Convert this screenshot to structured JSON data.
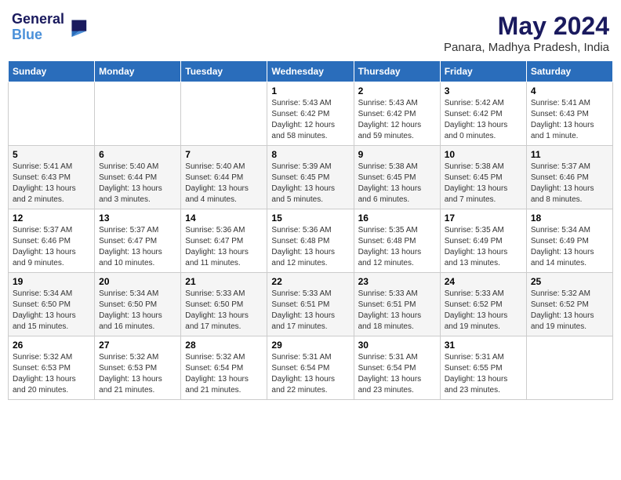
{
  "header": {
    "logo_line1": "General",
    "logo_line2": "Blue",
    "month_year": "May 2024",
    "location": "Panara, Madhya Pradesh, India"
  },
  "weekdays": [
    "Sunday",
    "Monday",
    "Tuesday",
    "Wednesday",
    "Thursday",
    "Friday",
    "Saturday"
  ],
  "weeks": [
    [
      {
        "day": "",
        "info": ""
      },
      {
        "day": "",
        "info": ""
      },
      {
        "day": "",
        "info": ""
      },
      {
        "day": "1",
        "info": "Sunrise: 5:43 AM\nSunset: 6:42 PM\nDaylight: 12 hours and 58 minutes."
      },
      {
        "day": "2",
        "info": "Sunrise: 5:43 AM\nSunset: 6:42 PM\nDaylight: 12 hours and 59 minutes."
      },
      {
        "day": "3",
        "info": "Sunrise: 5:42 AM\nSunset: 6:42 PM\nDaylight: 13 hours and 0 minutes."
      },
      {
        "day": "4",
        "info": "Sunrise: 5:41 AM\nSunset: 6:43 PM\nDaylight: 13 hours and 1 minute."
      }
    ],
    [
      {
        "day": "5",
        "info": "Sunrise: 5:41 AM\nSunset: 6:43 PM\nDaylight: 13 hours and 2 minutes."
      },
      {
        "day": "6",
        "info": "Sunrise: 5:40 AM\nSunset: 6:44 PM\nDaylight: 13 hours and 3 minutes."
      },
      {
        "day": "7",
        "info": "Sunrise: 5:40 AM\nSunset: 6:44 PM\nDaylight: 13 hours and 4 minutes."
      },
      {
        "day": "8",
        "info": "Sunrise: 5:39 AM\nSunset: 6:45 PM\nDaylight: 13 hours and 5 minutes."
      },
      {
        "day": "9",
        "info": "Sunrise: 5:38 AM\nSunset: 6:45 PM\nDaylight: 13 hours and 6 minutes."
      },
      {
        "day": "10",
        "info": "Sunrise: 5:38 AM\nSunset: 6:45 PM\nDaylight: 13 hours and 7 minutes."
      },
      {
        "day": "11",
        "info": "Sunrise: 5:37 AM\nSunset: 6:46 PM\nDaylight: 13 hours and 8 minutes."
      }
    ],
    [
      {
        "day": "12",
        "info": "Sunrise: 5:37 AM\nSunset: 6:46 PM\nDaylight: 13 hours and 9 minutes."
      },
      {
        "day": "13",
        "info": "Sunrise: 5:37 AM\nSunset: 6:47 PM\nDaylight: 13 hours and 10 minutes."
      },
      {
        "day": "14",
        "info": "Sunrise: 5:36 AM\nSunset: 6:47 PM\nDaylight: 13 hours and 11 minutes."
      },
      {
        "day": "15",
        "info": "Sunrise: 5:36 AM\nSunset: 6:48 PM\nDaylight: 13 hours and 12 minutes."
      },
      {
        "day": "16",
        "info": "Sunrise: 5:35 AM\nSunset: 6:48 PM\nDaylight: 13 hours and 12 minutes."
      },
      {
        "day": "17",
        "info": "Sunrise: 5:35 AM\nSunset: 6:49 PM\nDaylight: 13 hours and 13 minutes."
      },
      {
        "day": "18",
        "info": "Sunrise: 5:34 AM\nSunset: 6:49 PM\nDaylight: 13 hours and 14 minutes."
      }
    ],
    [
      {
        "day": "19",
        "info": "Sunrise: 5:34 AM\nSunset: 6:50 PM\nDaylight: 13 hours and 15 minutes."
      },
      {
        "day": "20",
        "info": "Sunrise: 5:34 AM\nSunset: 6:50 PM\nDaylight: 13 hours and 16 minutes."
      },
      {
        "day": "21",
        "info": "Sunrise: 5:33 AM\nSunset: 6:50 PM\nDaylight: 13 hours and 17 minutes."
      },
      {
        "day": "22",
        "info": "Sunrise: 5:33 AM\nSunset: 6:51 PM\nDaylight: 13 hours and 17 minutes."
      },
      {
        "day": "23",
        "info": "Sunrise: 5:33 AM\nSunset: 6:51 PM\nDaylight: 13 hours and 18 minutes."
      },
      {
        "day": "24",
        "info": "Sunrise: 5:33 AM\nSunset: 6:52 PM\nDaylight: 13 hours and 19 minutes."
      },
      {
        "day": "25",
        "info": "Sunrise: 5:32 AM\nSunset: 6:52 PM\nDaylight: 13 hours and 19 minutes."
      }
    ],
    [
      {
        "day": "26",
        "info": "Sunrise: 5:32 AM\nSunset: 6:53 PM\nDaylight: 13 hours and 20 minutes."
      },
      {
        "day": "27",
        "info": "Sunrise: 5:32 AM\nSunset: 6:53 PM\nDaylight: 13 hours and 21 minutes."
      },
      {
        "day": "28",
        "info": "Sunrise: 5:32 AM\nSunset: 6:54 PM\nDaylight: 13 hours and 21 minutes."
      },
      {
        "day": "29",
        "info": "Sunrise: 5:31 AM\nSunset: 6:54 PM\nDaylight: 13 hours and 22 minutes."
      },
      {
        "day": "30",
        "info": "Sunrise: 5:31 AM\nSunset: 6:54 PM\nDaylight: 13 hours and 23 minutes."
      },
      {
        "day": "31",
        "info": "Sunrise: 5:31 AM\nSunset: 6:55 PM\nDaylight: 13 hours and 23 minutes."
      },
      {
        "day": "",
        "info": ""
      }
    ]
  ]
}
